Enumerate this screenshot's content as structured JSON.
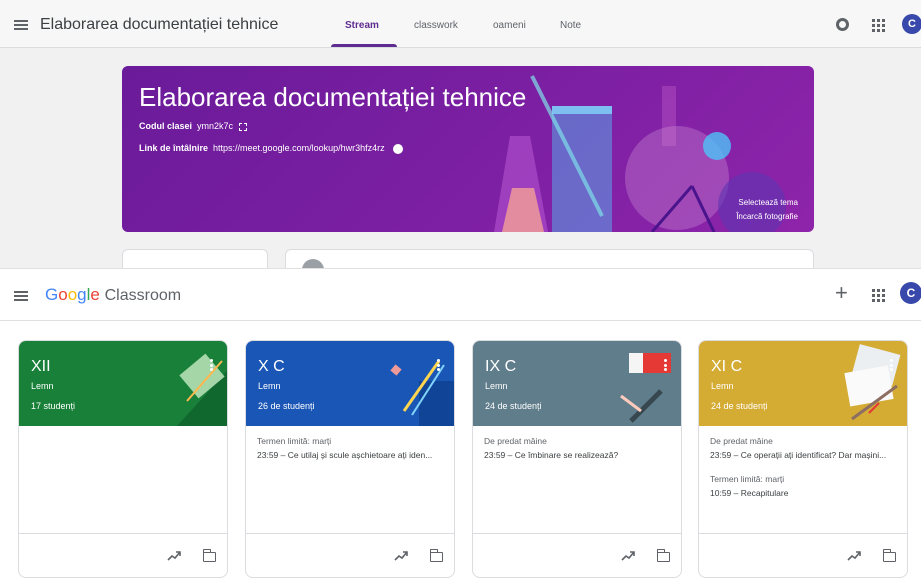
{
  "stream": {
    "title": "Elaborarea documentației tehnice",
    "tabs": [
      "Stream",
      "classwork",
      "oameni",
      "Note"
    ],
    "avatar_letter": "C",
    "banner": {
      "title": "Elaborarea documentației tehnice",
      "class_code_label": "Codul clasei",
      "class_code": "ymn2k7c",
      "meet_label": "Link de întâlnire",
      "meet_url": "https://meet.google.com/lookup/hwr3hfz4rz",
      "select_theme": "Selectează tema",
      "upload_photo": "Încarcă fotografie"
    },
    "accent_color": "#5f2d91"
  },
  "home": {
    "logo_google": "Google",
    "logo_classroom": "Classroom",
    "avatar_letter": "C",
    "cards": [
      {
        "title": "XII",
        "subtitle": "Lemn",
        "students": "17 studenți",
        "color": "#188038",
        "items": []
      },
      {
        "title": "X C",
        "subtitle": "Lemn",
        "students": "26 de studenți",
        "color": "#1a56b5",
        "items": [
          {
            "label": "Termen limită: marți",
            "text": "23:59 – Ce utilaj și scule așchietoare ați iden..."
          }
        ]
      },
      {
        "title": "IX C",
        "subtitle": "Lemn",
        "students": "24 de studenți",
        "color": "#607d8b",
        "items": [
          {
            "label": "De predat mâine",
            "text": "23:59 – Ce îmbinare se realizează?"
          }
        ]
      },
      {
        "title": "XI C",
        "subtitle": "Lemn",
        "students": "24 de studenți",
        "color": "#d4ac34",
        "items": [
          {
            "label": "De predat mâine",
            "text": "23:59 – Ce operații ați identificat? Dar mașini..."
          },
          {
            "label": "Termen limită: marți",
            "text": "10:59 – Recapitulare"
          }
        ]
      }
    ]
  }
}
